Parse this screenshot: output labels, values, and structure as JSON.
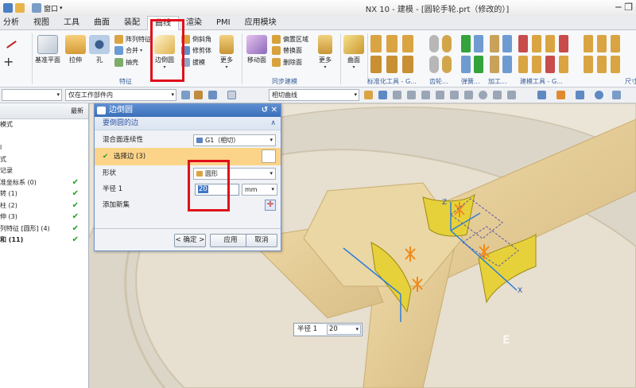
{
  "title_bar": {
    "menu_label": "窗口",
    "title": "NX 10 - 建模 - [圆轮手轮.prt（修改的）]"
  },
  "tabs": [
    "分析",
    "视图",
    "工具",
    "曲面",
    "装配",
    "曲线",
    "渲染",
    "PMI",
    "应用模块"
  ],
  "active_tab_index": 5,
  "ribbon": {
    "datum_plane": "基准平面",
    "extrude": "拉伸",
    "hole": "孔",
    "pattern_feature": "阵列特征",
    "unite": "合并",
    "draft": "抽壳",
    "edge_blend": "边倒圆",
    "chamfer": "倒斜角",
    "trim_body": "修剪体",
    "draft_face": "拔模",
    "more_1": "更多",
    "feature_group": "特征",
    "move_face": "移动面",
    "offset_region": "偏置区域",
    "replace_face": "替换面",
    "delete_face": "删除面",
    "more_2": "更多",
    "sync_group": "同步建模",
    "curve": "曲面",
    "std_tools": "标准化工具 - G...",
    "gear": "齿轮...",
    "spring": "弹簧...",
    "process": "加工...",
    "build_tools": "建模工具 - G...",
    "size": "尺寸"
  },
  "toolbar2": {
    "filter_combo": "",
    "scope_combo": "仅在工作部件内",
    "curve_rule_combo": "相切曲线"
  },
  "navigator": {
    "latest_header": "最新",
    "rows": [
      {
        "text": "模式",
        "check": ""
      },
      {
        "text": "",
        "check": ""
      },
      {
        "text": "l",
        "check": ""
      },
      {
        "text": "式",
        "check": ""
      },
      {
        "text": "记录",
        "check": ""
      },
      {
        "text": "准坐标系 (0)",
        "check": "✔"
      },
      {
        "text": "转 (1)",
        "check": "✔"
      },
      {
        "text": "柱 (2)",
        "check": "✔"
      },
      {
        "text": "伸 (3)",
        "check": "✔"
      },
      {
        "text": "列特征 [圆形] (4)",
        "check": "✔"
      },
      {
        "text": "和 (11)",
        "check": "✔",
        "bold": true
      }
    ]
  },
  "dialog": {
    "title": "边倒圆",
    "section": "要倒圆的边",
    "continuity_label": "混合面连续性",
    "continuity_value": "G1（相切）",
    "select_edge": "选择边 (3)",
    "shape_label": "形状",
    "shape_value": "圆形",
    "radius_label": "半径 1",
    "radius_value": "20",
    "unit": "mm",
    "add_set_label": "添加新集",
    "ok": "< 确定 >",
    "apply": "应用",
    "cancel": "取消"
  },
  "float_radius": {
    "label": "半径 1",
    "value": "20"
  },
  "watermark": "E",
  "colors": {
    "accent_red": "#e0101a",
    "dialog_title": "#3a6fb8",
    "selected_row": "#fcd489",
    "check_green": "#1ea11e"
  }
}
